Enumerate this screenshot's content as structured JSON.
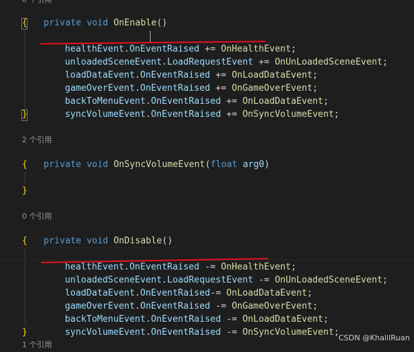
{
  "editor": {
    "top_partial_refs": "0 个引用",
    "method1": {
      "refs": "",
      "keyword1": "private",
      "keyword2": "void",
      "name": "OnEnable",
      "parens": "()",
      "open": "{",
      "close": "}",
      "statements": [
        {
          "obj": "healthEvent",
          "member": "OnEventRaised",
          "op": " += ",
          "handler": "OnHealthEvent",
          "end": ";"
        },
        {
          "obj": "unloadedSceneEvent",
          "member": "LoadRequestEvent",
          "op": " += ",
          "handler": "OnUnLoadedSceneEvent",
          "end": ";"
        },
        {
          "obj": "loadDataEvent",
          "member": "OnEventRaised",
          "op": " += ",
          "handler": "OnLoadDataEvent",
          "end": ";"
        },
        {
          "obj": "gameOverEvent",
          "member": "OnEventRaised",
          "op": " += ",
          "handler": "OnGameOverEvent",
          "end": ";"
        },
        {
          "obj": "backToMenuEvent",
          "member": "OnEventRaised",
          "op": " += ",
          "handler": "OnLoadDataEvent",
          "end": ";"
        },
        {
          "obj": "syncVolumeEvent",
          "member": "OnEventRaised",
          "op": " += ",
          "handler": "OnSyncVolumeEvent",
          "end": ";"
        }
      ]
    },
    "method2": {
      "refs": "2 个引用",
      "keyword1": "private",
      "keyword2": "void",
      "name": "OnSyncVolumeEvent",
      "paren_open": "(",
      "param_type": "float",
      "param_name": "arg0",
      "paren_close": ")",
      "open": "{",
      "close": "}"
    },
    "method3": {
      "refs": "0 个引用",
      "keyword1": "private",
      "keyword2": "void",
      "name": "OnDisable",
      "parens": "()",
      "open": "{",
      "close": "}",
      "statements": [
        {
          "obj": "healthEvent",
          "member": "OnEventRaised",
          "op": " -= ",
          "handler": "OnHealthEvent",
          "end": ";"
        },
        {
          "obj": "unloadedSceneEvent",
          "member": "LoadRequestEvent",
          "op": " -= ",
          "handler": "OnUnLoadedSceneEvent",
          "end": ";"
        },
        {
          "obj": "loadDataEvent",
          "member": "OnEventRaised",
          "op": "-= ",
          "handler": "OnLoadDataEvent",
          "end": ";"
        },
        {
          "obj": "gameOverEvent",
          "member": "OnEventRaised",
          "op": " -= ",
          "handler": "OnGameOverEvent",
          "end": ";"
        },
        {
          "obj": "backToMenuEvent",
          "member": "OnEventRaised",
          "op": " -= ",
          "handler": "OnLoadDataEvent",
          "end": ";"
        },
        {
          "obj": "syncVolumeEvent",
          "member": "OnEventRaised",
          "op": " -= ",
          "handler": "OnSyncVolumeEvent",
          "end": ";"
        }
      ]
    },
    "bottom_partial_refs": "1 个引用"
  },
  "watermark": "CSDN @KhalilRuan",
  "colors": {
    "background": "#1e1e1e",
    "keyword": "#569cd6",
    "method": "#dcdcaa",
    "variable": "#9cdcfe",
    "brace": "#ffd700",
    "annotation_underline": "#e81123"
  }
}
